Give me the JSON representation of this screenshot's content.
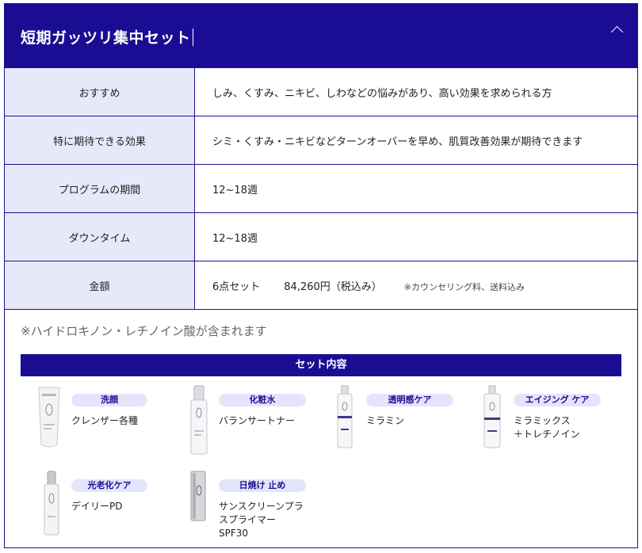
{
  "header": {
    "title": "短期ガッツリ集中セット"
  },
  "rows": [
    {
      "label": "おすすめ",
      "value": "しみ、くすみ、ニキビ、しわなどの悩みがあり、高い効果を求められる方"
    },
    {
      "label": "特に期待できる効果",
      "value": "シミ・くすみ・ニキビなどターンオーバーを早め、肌質改善効果が期待できます"
    },
    {
      "label": "プログラムの期間",
      "value": "12~18週"
    },
    {
      "label": "ダウンタイム",
      "value": "12~18週"
    }
  ],
  "price": {
    "label": "金額",
    "set": "6点セット",
    "amount": "84,260円（税込み）",
    "note": "※カウンセリング料、送料込み"
  },
  "note": "※ハイドロキノン・レチノイン酸が含まれます",
  "set_title": "セット内容",
  "items": [
    {
      "category": "洗顔",
      "name_lines": [
        "クレンザー各種"
      ]
    },
    {
      "category": "化粧水",
      "name_lines": [
        "バランサートナー"
      ]
    },
    {
      "category": "透明感ケア",
      "name_lines": [
        "ミラミン"
      ]
    },
    {
      "category": "エイジング ケア",
      "name_lines": [
        "ミラミックス",
        "＋トレチノイン"
      ]
    },
    {
      "category": "光老化ケア",
      "name_lines": [
        "デイリーPD"
      ]
    },
    {
      "category": "日焼け 止め",
      "name_lines": [
        "サンスクリーンプラ",
        "スプライマー",
        "SPF30"
      ]
    }
  ],
  "colors": {
    "brand": "#1b0d93",
    "label_bg": "#e8e8fb",
    "badge_bg": "#e4e4fb"
  }
}
